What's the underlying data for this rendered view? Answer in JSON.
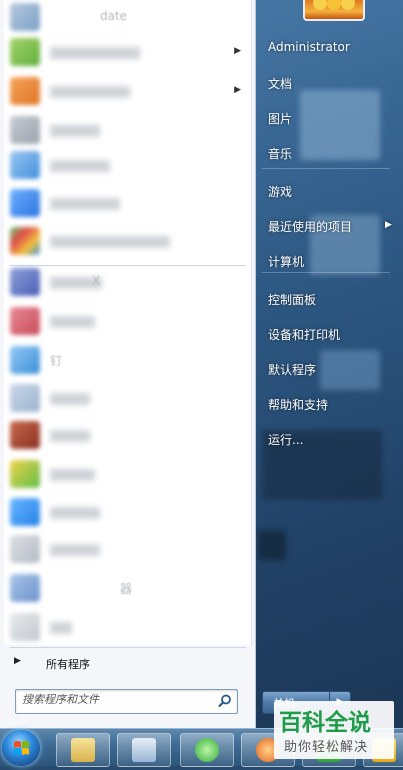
{
  "colors": {
    "menu_left_bg": "#ffffff",
    "menu_right_text": "#ffffff",
    "taskbar": "#3d6a93",
    "watermark_green": "#1f9c4a"
  },
  "left_pane": {
    "programs": [
      {
        "label": "date",
        "has_submenu": false,
        "icon": "blurred-app-icon"
      },
      {
        "label": "",
        "has_submenu": true,
        "icon": "blurred-app-icon"
      },
      {
        "label": "",
        "has_submenu": true,
        "icon": "blurred-app-icon"
      },
      {
        "label": "",
        "has_submenu": false,
        "icon": "blurred-app-icon"
      },
      {
        "label": "",
        "has_submenu": false,
        "icon": "blurred-app-icon"
      },
      {
        "label": "",
        "has_submenu": false,
        "icon": "blurred-app-icon"
      },
      {
        "label": "",
        "has_submenu": false,
        "icon": "blurred-app-icon"
      },
      {
        "label": "X",
        "has_submenu": false,
        "icon": "blurred-app-icon"
      },
      {
        "label": "",
        "has_submenu": false,
        "icon": "blurred-app-icon"
      },
      {
        "label": "钉",
        "has_submenu": false,
        "icon": "blurred-app-icon"
      },
      {
        "label": "",
        "has_submenu": false,
        "icon": "blurred-app-icon"
      },
      {
        "label": "",
        "has_submenu": false,
        "icon": "blurred-app-icon"
      },
      {
        "label": "",
        "has_submenu": false,
        "icon": "blurred-app-icon"
      },
      {
        "label": "",
        "has_submenu": false,
        "icon": "blurred-app-icon"
      },
      {
        "label": "",
        "has_submenu": false,
        "icon": "blurred-app-icon"
      },
      {
        "label": "器",
        "has_submenu": false,
        "icon": "blurred-app-icon"
      },
      {
        "label": "",
        "has_submenu": false,
        "icon": "blurred-app-icon"
      }
    ],
    "all_programs": "所有程序",
    "search_placeholder": "搜索程序和文件"
  },
  "right_pane": {
    "user_name": "Administrator",
    "items": [
      {
        "label": "文档",
        "has_submenu": false
      },
      {
        "label": "图片",
        "has_submenu": false
      },
      {
        "label": "音乐",
        "has_submenu": false
      },
      {
        "label": "游戏",
        "has_submenu": false
      },
      {
        "label": "最近使用的项目",
        "has_submenu": true
      },
      {
        "label": "计算机",
        "has_submenu": false
      },
      {
        "label": "控制面板",
        "has_submenu": false
      },
      {
        "label": "设备和打印机",
        "has_submenu": false
      },
      {
        "label": "默认程序",
        "has_submenu": false
      },
      {
        "label": "帮助和支持",
        "has_submenu": false
      },
      {
        "label": "运行...",
        "has_submenu": false
      }
    ],
    "shutdown_label": "关机"
  },
  "watermark": {
    "title": "百科全说",
    "subtitle": "助你轻松解决"
  }
}
